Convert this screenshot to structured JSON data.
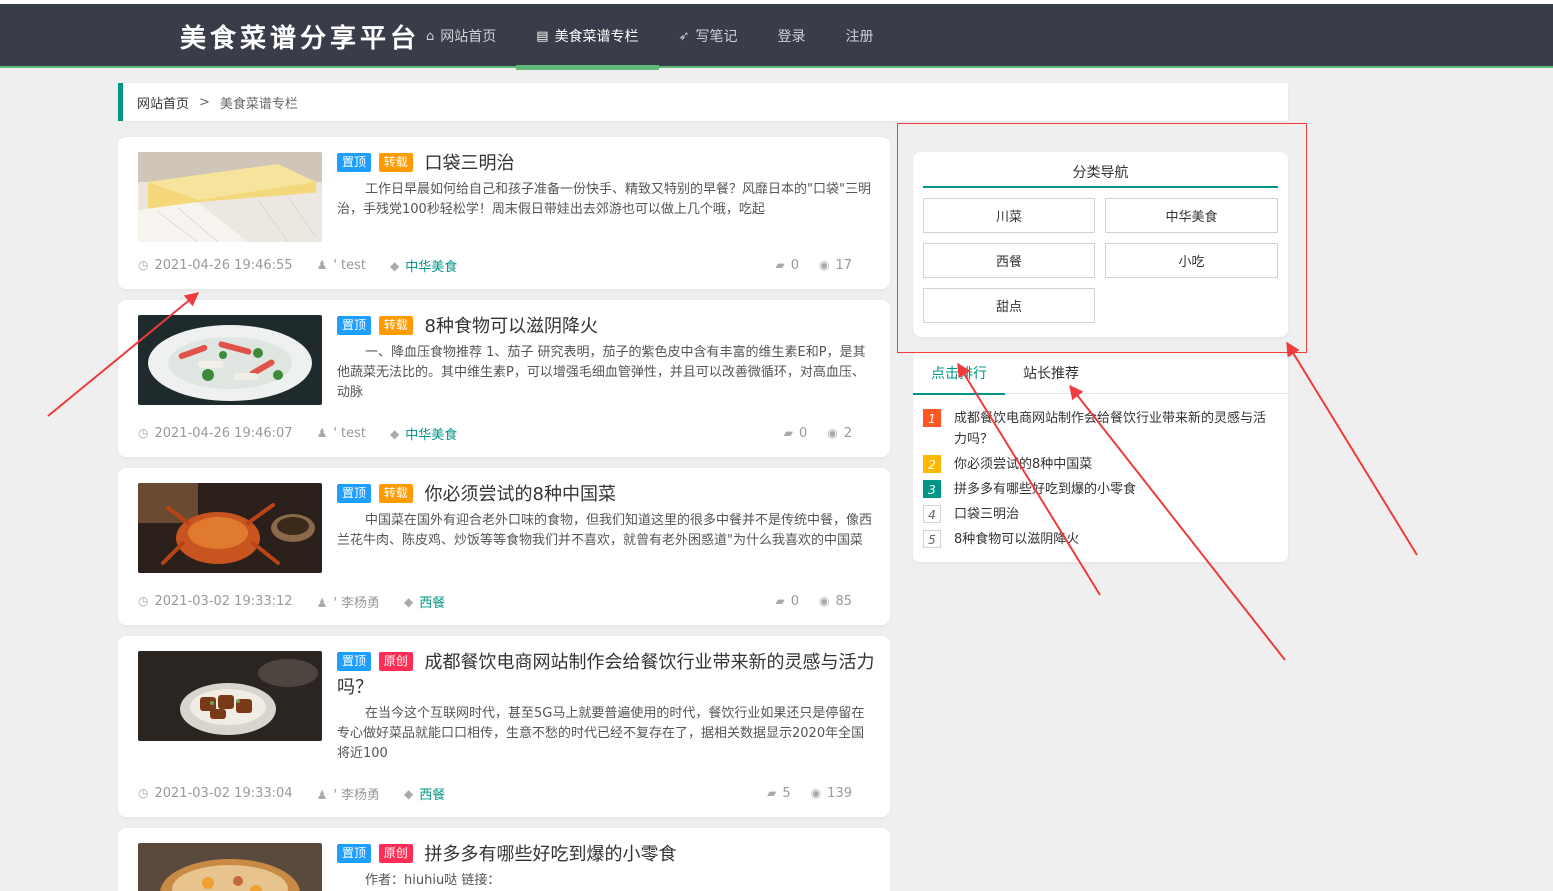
{
  "header": {
    "logo": "美食菜谱分享平台",
    "nav": [
      {
        "label": "网站首页",
        "icon": "home-icon"
      },
      {
        "label": "美食菜谱专栏",
        "icon": "document-icon"
      },
      {
        "label": "写笔记",
        "icon": "paper-plane-icon"
      },
      {
        "label": "登录"
      },
      {
        "label": "注册"
      }
    ]
  },
  "breadcrumb": {
    "home": "网站首页",
    "separator": ">",
    "current": "美食菜谱专栏"
  },
  "articles": [
    {
      "badges": [
        "置顶",
        "转载"
      ],
      "title": "口袋三明治",
      "summary": "工作日早晨如何给自己和孩子准备一份快手、精致又特别的早餐？风靡日本的\"口袋\"三明治，手残党100秒轻松学！周末假日带娃出去郊游也可以做上几个哦，吃起",
      "time": "2021-04-26 19:46:55",
      "author": "' test",
      "tag": "中华美食",
      "comments": "0",
      "views": "17"
    },
    {
      "badges": [
        "置顶",
        "转载"
      ],
      "title": "8种食物可以滋阴降火",
      "summary": "一、降血压食物推荐 1、茄子 研究表明，茄子的紫色皮中含有丰富的维生素E和P，是其他蔬菜无法比的。其中维生素P，可以增强毛细血管弹性，并且可以改善微循环，对高血压、动脉",
      "time": "2021-04-26 19:46:07",
      "author": "' test",
      "tag": "中华美食",
      "comments": "0",
      "views": "2"
    },
    {
      "badges": [
        "置顶",
        "转载"
      ],
      "title": "你必须尝试的8种中国菜",
      "summary": "中国菜在国外有迎合老外口味的食物，但我们知道这里的很多中餐并不是传统中餐，像西兰花牛肉、陈皮鸡、炒饭等等食物我们并不喜欢，就曾有老外困惑道\"为什么我喜欢的中国菜",
      "time": "2021-03-02 19:33:12",
      "author": "' 李杨勇",
      "tag": "西餐",
      "comments": "0",
      "views": "85"
    },
    {
      "badges": [
        "置顶",
        "原创"
      ],
      "title": "成都餐饮电商网站制作会给餐饮行业带来新的灵感与活力吗？",
      "summary": "在当今这个互联网时代，甚至5G马上就要普遍使用的时代，餐饮行业如果还只是停留在专心做好菜品就能口口相传，生意不愁的时代已经不复存在了，据相关数据显示2020年全国将近100",
      "time": "2021-03-02 19:33:04",
      "author": "' 李杨勇",
      "tag": "西餐",
      "comments": "5",
      "views": "139"
    },
    {
      "badges": [
        "置顶",
        "原创"
      ],
      "title": "拼多多有哪些好吃到爆的小零食",
      "summary": "作者：hiuhiu哒 链接：",
      "time": "",
      "author": "",
      "tag": "",
      "comments": "",
      "views": ""
    }
  ],
  "sidebar": {
    "category_title": "分类导航",
    "categories": [
      "川菜",
      "中华美食",
      "西餐",
      "小吃",
      "甜点"
    ],
    "tabs": [
      "点击排行",
      "站长推荐"
    ],
    "ranking": [
      {
        "num": "1",
        "title": "成都餐饮电商网站制作会给餐饮行业带来新的灵感与活力吗？"
      },
      {
        "num": "2",
        "title": "你必须尝试的8种中国菜"
      },
      {
        "num": "3",
        "title": "拼多多有哪些好吃到爆的小零食"
      },
      {
        "num": "4",
        "title": "口袋三明治"
      },
      {
        "num": "5",
        "title": "8种食物可以滋阴降火"
      }
    ]
  },
  "colors": {
    "header_bg": "#393d49",
    "accent": "#009688",
    "nav_active": "#5fb878",
    "badge_top": "#1e9fff",
    "badge_repost": "#ff9a00",
    "badge_original": "#ff2d55",
    "annotation": "#ef3b3b"
  }
}
